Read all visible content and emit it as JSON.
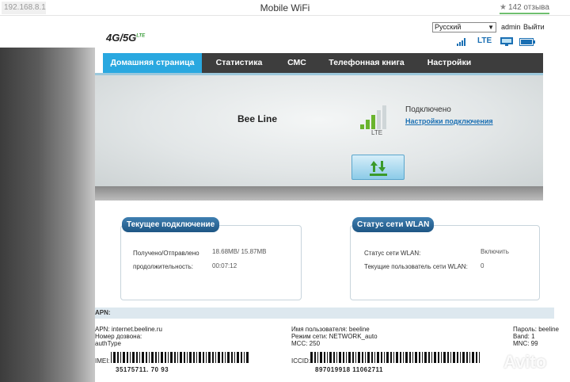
{
  "browser": {
    "address": "192.168.8.1",
    "title": "Mobile WiFi",
    "reviews": "142 отзыва"
  },
  "header": {
    "logo": "4G/5G",
    "logo_suffix": "LTE",
    "language": "Русский",
    "user": "admin",
    "logout": "Выйти",
    "network_type": "LTE",
    "icons": [
      "signal-icon",
      "monitor-icon",
      "battery-icon"
    ]
  },
  "nav": {
    "items": [
      {
        "label": "Домашняя страница",
        "active": true
      },
      {
        "label": "Статистика"
      },
      {
        "label": "СМС"
      },
      {
        "label": "Телефонная книга"
      },
      {
        "label": "Настройки"
      }
    ]
  },
  "status": {
    "operator": "Bee Line",
    "signal_type": "LTE",
    "state": "Подключено",
    "settings_link": "Настройки подключения",
    "signal_bars": 3,
    "signal_bars_total": 5
  },
  "current_connection": {
    "title": "Текущее подключение",
    "rows": [
      {
        "label": "Получено/Отправлено",
        "value": "18.68MB/ 15.87MB"
      },
      {
        "label": "продолжительность:",
        "value": "00:07:12"
      }
    ]
  },
  "wlan_status": {
    "title": "Статус сети WLAN",
    "rows": [
      {
        "label": "Статус сети WLAN:",
        "value": "Включить"
      },
      {
        "label": "Текущие пользователь сети WLAN:",
        "value": "0"
      }
    ]
  },
  "device_info": {
    "apn_header": "APN:",
    "col1": [
      "APN: internet.beeline.ru",
      "Номер дозвона:",
      "authType"
    ],
    "col2": [
      "Имя пользователя: beeline",
      "Режим сети: NETWORK_auto",
      "MCC: 250"
    ],
    "col3": [
      "Пароль: beeline",
      "Band:  1",
      "MNC: 99"
    ],
    "imei_label": "IMEI:",
    "imei": "35175711. 70 93",
    "iccid_label": "ICCID:",
    "iccid": "897019918 11062711"
  },
  "watermark": "Avito",
  "colors": {
    "nav_bg": "#3d3d3d",
    "nav_active": "#29a8e0",
    "panel_tab": "#1e5684",
    "link": "#1a6fb3",
    "signal_green": "#6ab42d"
  }
}
